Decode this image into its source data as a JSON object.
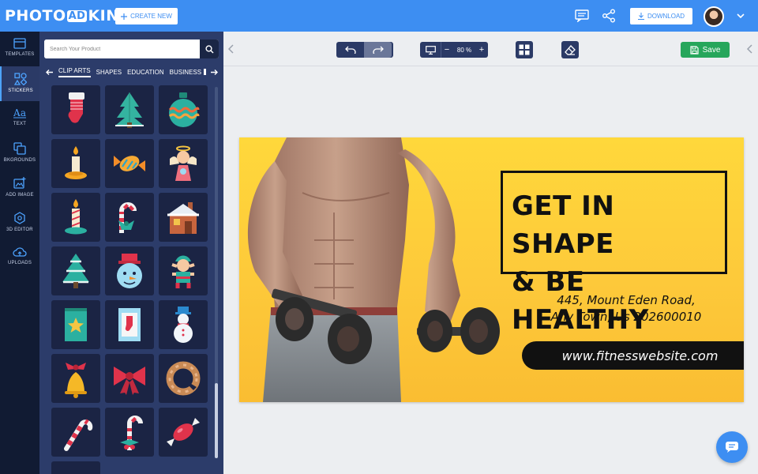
{
  "app": {
    "logo_pre": "PHOTO",
    "logo_mid": "AD",
    "logo_post": "KING",
    "create_label": "CREATE NEW",
    "download_label": "DOWNLOAD"
  },
  "nav": [
    {
      "label": "TEMPLATES",
      "icon": "templates-icon"
    },
    {
      "label": "STICKERS",
      "icon": "stickers-icon"
    },
    {
      "label": "TEXT",
      "icon": "text-icon"
    },
    {
      "label": "BKGROUNDS",
      "icon": "backgrounds-icon"
    },
    {
      "label": "ADD IMAGE",
      "icon": "add-image-icon"
    },
    {
      "label": "3D EDITOR",
      "icon": "3d-editor-icon"
    },
    {
      "label": "UPLOADS",
      "icon": "uploads-icon"
    }
  ],
  "panel": {
    "search_placeholder": "Search Your Product",
    "categories": [
      "CLIP ARTS",
      "SHAPES",
      "EDUCATION",
      "BUSINESS"
    ],
    "active_category": "CLIP ARTS",
    "stickers": [
      "stocking",
      "christmas-tree",
      "ornament",
      "candle",
      "candy",
      "angel",
      "candle-2",
      "candy-cane-ribbon",
      "snowy-house",
      "snowy-tree",
      "snowman-face",
      "elf",
      "card-star",
      "card-stocking",
      "snowman",
      "bell-ribbon",
      "bow",
      "wreath",
      "candy-cane",
      "candy-cane-holly",
      "candy-wrapped"
    ]
  },
  "toolbar": {
    "zoom": "80 %",
    "zoom_minus": "−",
    "zoom_plus": "+",
    "save_label": "Save"
  },
  "design": {
    "headline_1": "GET IN SHAPE",
    "headline_2": "& BE HEALTHY",
    "address_1": "445, Mount Eden Road,",
    "address_2": "Any Town, Us 202600010",
    "url": "www.fitnesswebsite.com"
  },
  "colors": {
    "accent": "#3d8ef2",
    "nav_bg": "#111b33",
    "panel_bg": "#2c3c6a",
    "save_green": "#26a65b",
    "design_yellow": "#fdc93a"
  }
}
